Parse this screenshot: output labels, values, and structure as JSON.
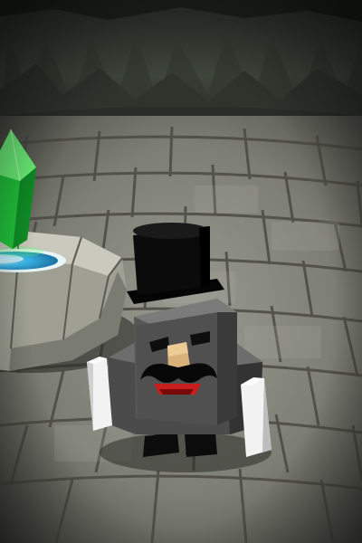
{
  "scene": {
    "setting": "dungeon-cave",
    "objects": [
      {
        "name": "green-crystal",
        "kind": "collectible"
      },
      {
        "name": "stone-fountain-pedestal",
        "kind": "terrain"
      },
      {
        "name": "top-hat-block-character",
        "kind": "player-character"
      }
    ]
  },
  "colors": {
    "cave_wall": "#3c4138",
    "floor_stone": "#8d8e83",
    "floor_grout": "#4a4a42",
    "crystal": "#1fd33a",
    "water": "#3ab4e6",
    "character_body": "#4a4a4a",
    "hat": "#0b0b0b",
    "mouth": "#c81e1e"
  }
}
